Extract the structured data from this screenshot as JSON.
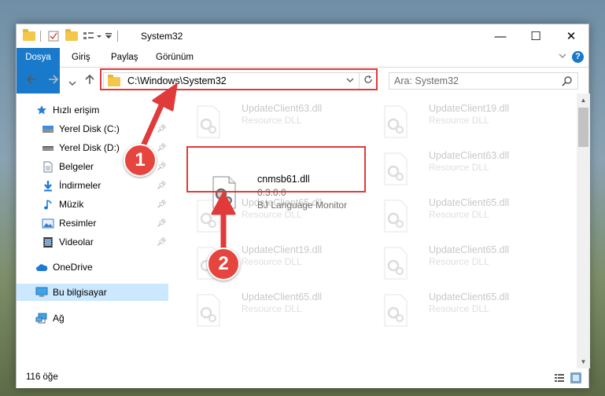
{
  "window": {
    "title": "System32",
    "controls": {
      "minimize": "—",
      "maximize": "☐",
      "close": "✕"
    }
  },
  "ribbon": {
    "tabs": [
      "Dosya",
      "Giriş",
      "Paylaş",
      "Görünüm"
    ]
  },
  "address": {
    "path": "C:\\Windows\\System32",
    "search_placeholder": "Ara: System32"
  },
  "sidebar": {
    "quick_access": "Hızlı erişim",
    "items": [
      {
        "label": "Yerel Disk (C:)",
        "icon": "drive-icon",
        "pinned": true
      },
      {
        "label": "Yerel Disk (D:)",
        "icon": "drive-icon",
        "pinned": true
      },
      {
        "label": "Belgeler",
        "icon": "documents-icon",
        "pinned": true
      },
      {
        "label": "İndirmeler",
        "icon": "downloads-icon",
        "pinned": true
      },
      {
        "label": "Müzik",
        "icon": "music-icon",
        "pinned": true
      },
      {
        "label": "Resimler",
        "icon": "pictures-icon",
        "pinned": true
      },
      {
        "label": "Videolar",
        "icon": "videos-icon",
        "pinned": true
      }
    ],
    "onedrive": "OneDrive",
    "this_pc": "Bu bilgisayar",
    "network": "Ağ"
  },
  "files": {
    "highlighted": {
      "name": "cnmsb61.dll",
      "version": "0.3.0.0",
      "description": "BJ Language Monitor"
    },
    "background": [
      {
        "name": "UpdateClient63.dll",
        "type": "Resource DLL"
      },
      {
        "name": "UpdateClient19.dll",
        "type": "Resource DLL"
      },
      {
        "name": "UpdateClient63.dll",
        "type": "Resource DLL"
      },
      {
        "name": "UpdateClient65.dll",
        "type": "Resource DLL"
      },
      {
        "name": "UpdateClient65.dll",
        "type": "Resource DLL"
      },
      {
        "name": "UpdateClient19.dll",
        "type": "Resource DLL"
      },
      {
        "name": "UpdateClient65.dll",
        "type": "Resource DLL"
      },
      {
        "name": "UpdateClient65.dll",
        "type": "Resource DLL"
      },
      {
        "name": "UpdateClient65.dll",
        "type": "Resource DLL"
      }
    ]
  },
  "status": {
    "item_count": "116 öğe"
  },
  "annotations": {
    "step1": "1",
    "step2": "2",
    "color": "#e03a3a"
  }
}
